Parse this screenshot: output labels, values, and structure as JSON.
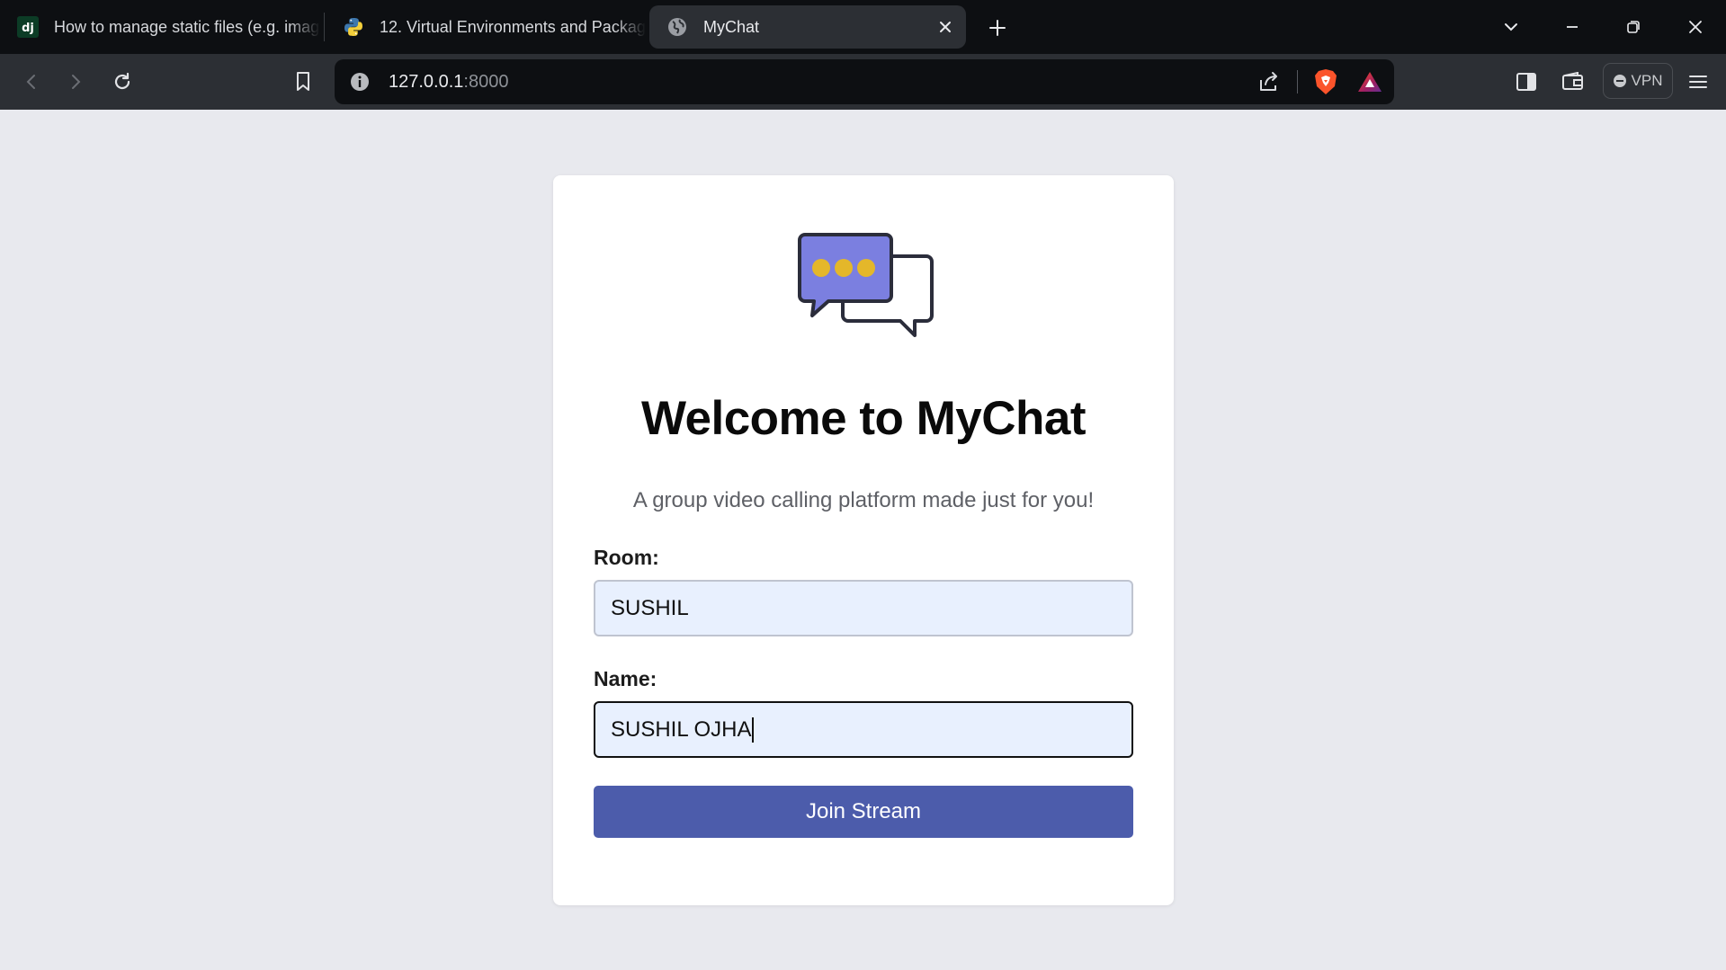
{
  "browser": {
    "tabs": [
      {
        "favicon": "django-icon",
        "title": "How to manage static files (e.g. imag"
      },
      {
        "favicon": "python-icon",
        "title": "12. Virtual Environments and Packag"
      },
      {
        "favicon": "globe-icon",
        "title": "MyChat",
        "active": true
      }
    ],
    "url": {
      "host": "127.0.0.1",
      "port": ":8000"
    },
    "vpn_label": "VPN",
    "colors": {
      "tabbar": "#0d0f12",
      "toolbar": "#2c2f34",
      "active_tab": "#2c2f34"
    }
  },
  "page": {
    "logo": "chat-bubbles-icon",
    "title": "Welcome to MyChat",
    "subtitle": "A group video calling platform made just for you!",
    "room": {
      "label": "Room:",
      "value": "SUSHIL"
    },
    "name": {
      "label": "Name:",
      "value": "SUSHIL OJHA"
    },
    "join_label": "Join Stream",
    "colors": {
      "background": "#e8e9ee",
      "button": "#4c5cab",
      "input_bg": "#e8f0fe",
      "logo_bubble": "#7b7fe0",
      "logo_dots": "#e4b72a"
    }
  }
}
